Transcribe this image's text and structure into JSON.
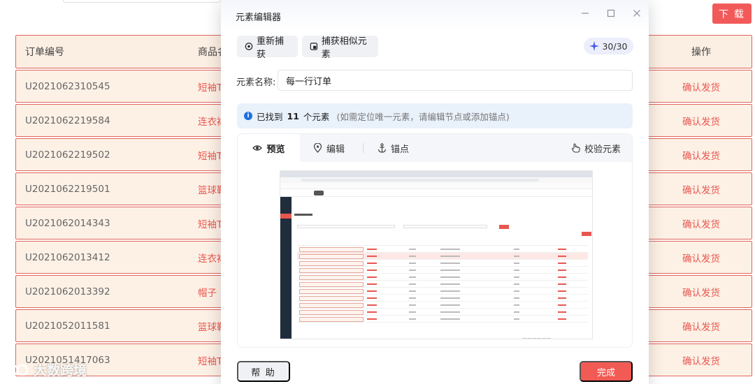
{
  "page": {
    "download_label": "下 载",
    "table": {
      "headers": {
        "order_id": "订单编号",
        "product": "商品名",
        "operation": "操作"
      },
      "rows": [
        {
          "order_id": "U2021062310545",
          "product": "短袖T",
          "action": "确认发货"
        },
        {
          "order_id": "U2021062219584",
          "product": "连衣裙",
          "action": "确认发货"
        },
        {
          "order_id": "U2021062219502",
          "product": "短袖T",
          "action": "确认发货"
        },
        {
          "order_id": "U2021062219501",
          "product": "篮球鞋",
          "action": "确认发货"
        },
        {
          "order_id": "U2021062014343",
          "product": "短袖T",
          "action": "确认发货"
        },
        {
          "order_id": "U2021062013412",
          "product": "连衣裙",
          "action": "确认发货"
        },
        {
          "order_id": "U2021062013392",
          "product": "帽子",
          "action": "确认发货"
        },
        {
          "order_id": "U2021052011581",
          "product": "篮球鞋",
          "action": "确认发货"
        },
        {
          "order_id": "U2021051417063",
          "product": "短袖T",
          "action": "确认发货"
        }
      ]
    },
    "watermark": "大数跨境"
  },
  "modal": {
    "title": "元素编辑器",
    "recapture_label": "重新捕获",
    "capture_similar_label": "捕获相似元素",
    "badge": "30/30",
    "name_label": "元素名称:",
    "name_value": "每一行订单",
    "info": {
      "prefix": "已找到",
      "count": "11",
      "suffix": "个元素",
      "hint": "(如需定位唯一元素，请编辑节点或添加锚点)"
    },
    "tabs": {
      "preview": "预览",
      "edit": "编辑",
      "anchor": "锚点",
      "verify": "校验元素"
    },
    "help_label": "帮 助",
    "done_label": "完成"
  },
  "colors": {
    "accent_red": "#f25a5a",
    "row_bg": "#fdf1e6",
    "row_border": "#e0655d",
    "info_blue": "#1f6fe6"
  }
}
